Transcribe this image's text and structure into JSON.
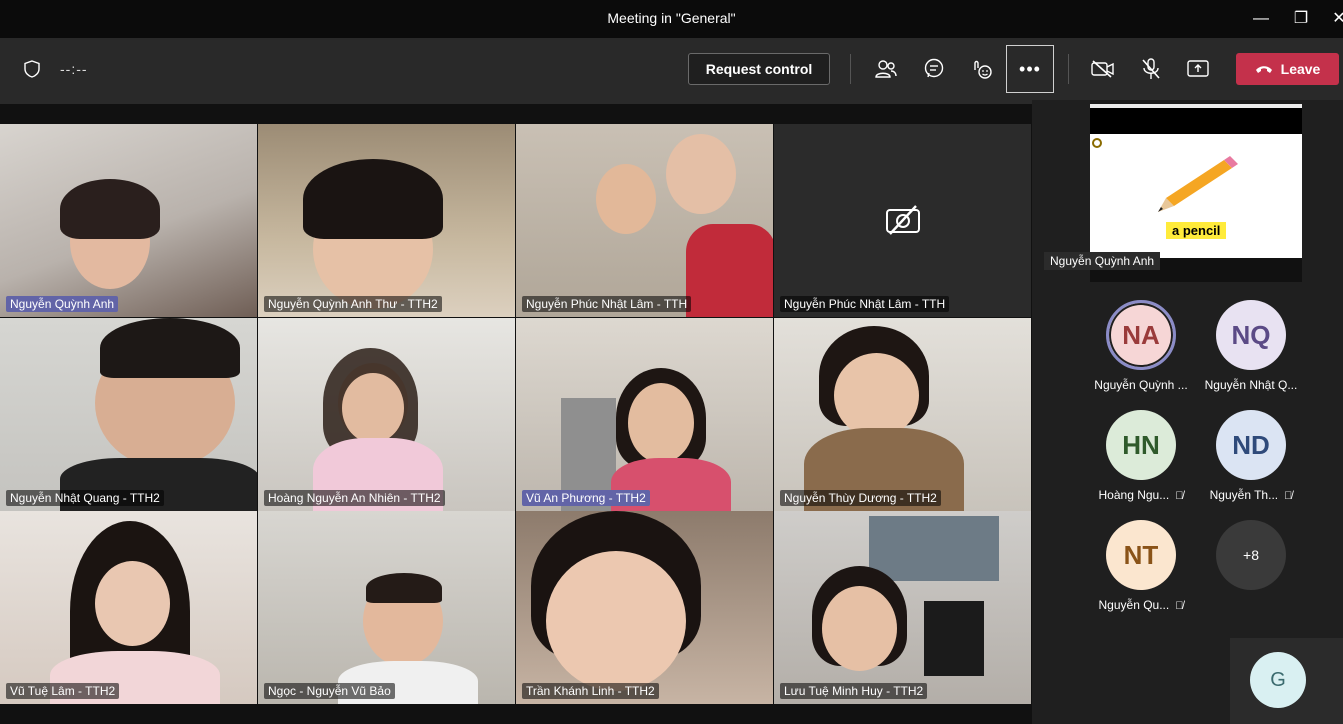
{
  "window": {
    "title": "Meeting in \"General\""
  },
  "toolbar": {
    "timer": "--:--",
    "request_control_label": "Request control",
    "more_label": "•••",
    "leave_label": "Leave"
  },
  "tiles": [
    {
      "name": "Nguyễn Quỳnh Anh",
      "active": true
    },
    {
      "name": "Nguyễn Quỳnh Anh Thư - TTH2"
    },
    {
      "name": "Nguyễn Phúc Nhật Lâm - TTH"
    },
    {
      "name": "Nguyễn Phúc Nhật Lâm - TTH"
    },
    {
      "name": "Nguyễn Nhật Quang - TTH2"
    },
    {
      "name": "Hoàng Nguyễn An Nhiên - TTH2"
    },
    {
      "name": "Vũ An Phương - TTH2",
      "active": true
    },
    {
      "name": "Nguyễn Thùy Dương - TTH2"
    },
    {
      "name": "Vũ Tuệ Lâm - TTH2"
    },
    {
      "name": "Ngọc - Nguyễn Vũ Bảo"
    },
    {
      "name": "Trần Khánh Linh - TTH2"
    },
    {
      "name": "Lưu Tuệ Minh Huy - TTH2"
    }
  ],
  "shared_screen": {
    "label": "a pencil",
    "presenter": "Nguyễn Quỳnh Anh"
  },
  "participants": [
    {
      "initials": "NA",
      "name": "Nguyễn Quỳnh ...",
      "bg": "#f6d6d6",
      "fg": "#9a3b3b"
    },
    {
      "initials": "NQ",
      "name": "Nguyễn Nhật Q...",
      "bg": "#e8e2f2",
      "fg": "#5b4a86"
    },
    {
      "initials": "HN",
      "name": "Hoàng Ngu...",
      "bg": "#dcebd9",
      "fg": "#2f5a2b"
    },
    {
      "initials": "ND",
      "name": "Nguyễn Th...",
      "bg": "#dbe4f3",
      "fg": "#2f4a7a"
    },
    {
      "initials": "NT",
      "name": "Nguyễn Qu...",
      "bg": "#fbe6cf",
      "fg": "#8a5318"
    },
    {
      "initials": "+8",
      "name": "",
      "bg": "#3a3a3a",
      "fg": "#ffffff"
    }
  ],
  "self_avatar": {
    "initials": "G"
  },
  "colors": {
    "leave": "#c4314b",
    "accent": "#6264a7"
  }
}
